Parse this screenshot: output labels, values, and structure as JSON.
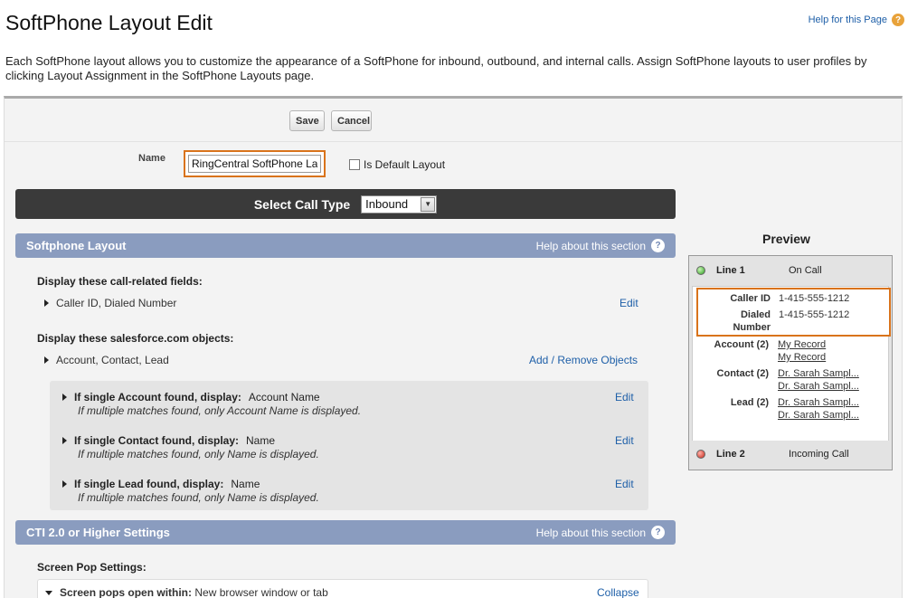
{
  "page": {
    "title": "SoftPhone Layout Edit",
    "help_link": "Help for this Page",
    "description": "Each SoftPhone layout allows you to customize the appearance of a SoftPhone for inbound, outbound, and internal calls. Assign SoftPhone layouts to user profiles by clicking Layout Assignment in the SoftPhone Layouts page."
  },
  "buttons": {
    "save": "Save",
    "cancel": "Cancel"
  },
  "form": {
    "name_label": "Name",
    "name_value": "RingCentral SoftPhone La",
    "default_label": "Is Default Layout",
    "default_checked": false
  },
  "call_type": {
    "label": "Select Call Type",
    "selected": "Inbound"
  },
  "softphone_section": {
    "title": "Softphone Layout",
    "help": "Help about this section",
    "fields_heading": "Display these call-related fields:",
    "fields_value": "Caller ID, Dialed Number",
    "fields_action": "Edit",
    "objects_heading": "Display these salesforce.com objects:",
    "objects_value": "Account, Contact, Lead",
    "objects_action": "Add / Remove Objects",
    "rules": [
      {
        "prefix": "If single Account found, display:",
        "value": "Account Name",
        "note": "If multiple matches found, only Account Name is displayed.",
        "action": "Edit"
      },
      {
        "prefix": "If single Contact found, display:",
        "value": "Name",
        "note": "If multiple matches found, only Name is displayed.",
        "action": "Edit"
      },
      {
        "prefix": "If single Lead found, display:",
        "value": "Name",
        "note": "If multiple matches found, only Name is displayed.",
        "action": "Edit"
      }
    ]
  },
  "cti_section": {
    "title": "CTI 2.0 or Higher Settings",
    "help": "Help about this section",
    "screen_pop_heading": "Screen Pop Settings:",
    "screen_pop_label": "Screen pops open within:",
    "screen_pop_value": "New browser window or tab",
    "collapse": "Collapse"
  },
  "preview": {
    "title": "Preview",
    "line1_name": "Line 1",
    "line1_status": "On Call",
    "caller_id_label": "Caller ID",
    "caller_id_value": "1-415-555-1212",
    "dialed_label_1": "Dialed",
    "dialed_label_2": "Number",
    "dialed_value": "1-415-555-1212",
    "account_label": "Account (2)",
    "account_links": [
      "My Record",
      "My Record"
    ],
    "contact_label": "Contact (2)",
    "contact_links": [
      "Dr. Sarah Sampl...",
      "Dr. Sarah Sampl..."
    ],
    "lead_label": "Lead (2)",
    "lead_links": [
      "Dr. Sarah Sampl...",
      "Dr. Sarah Sampl..."
    ],
    "line2_name": "Line 2",
    "line2_status": "Incoming Call"
  },
  "colors": {
    "section_header": "#8a9cbf",
    "call_type_bar": "#3a3a3a",
    "highlight_border": "#d9731b",
    "link": "#1e5fa8"
  }
}
